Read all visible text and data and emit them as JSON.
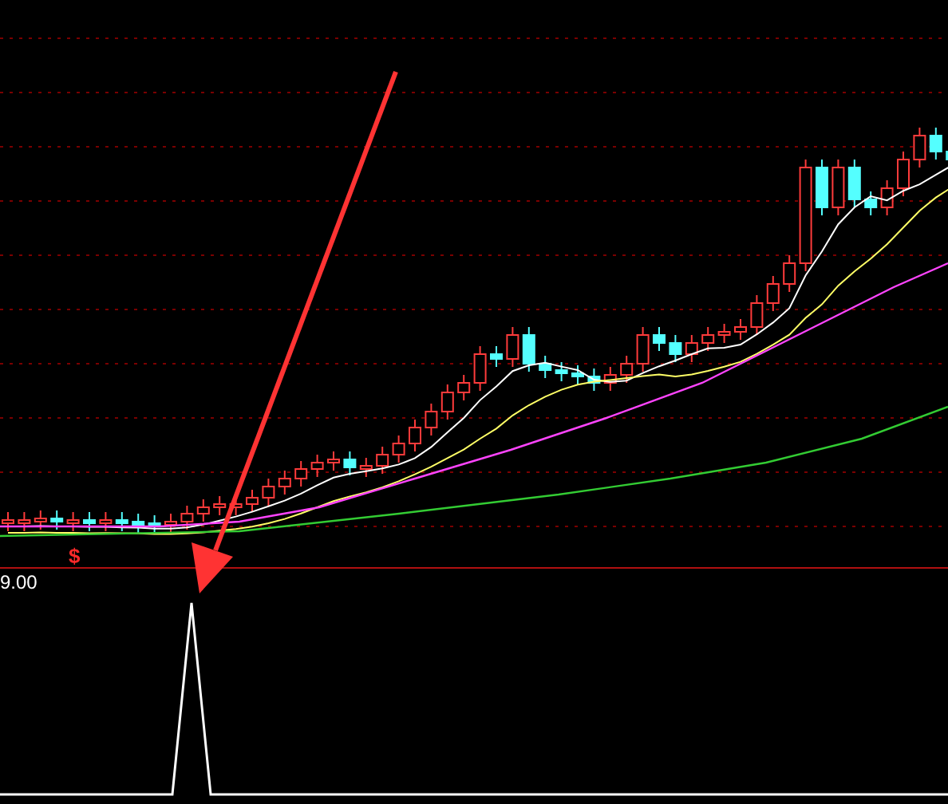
{
  "main_chart": {
    "signal_mark": "$"
  },
  "indicator_panel": {
    "value_label": "9.00"
  }
}
